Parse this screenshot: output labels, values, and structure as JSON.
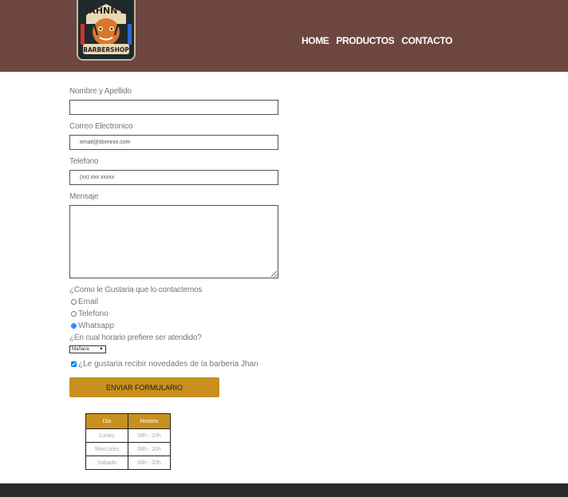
{
  "logo": {
    "line1": "JAHNN'S",
    "line2": "BARBERSHOP"
  },
  "nav": {
    "home": "HOME",
    "products": "PRODUCTOS",
    "contact": "CONTACTO"
  },
  "form": {
    "name_label": "Nombre y Apellido",
    "name_value": "",
    "email_label": "Correo Electronico",
    "email_placeholder": "email@dominio.com",
    "phone_label": "Telefono",
    "phone_placeholder": "(xx) xxx xxxxx",
    "message_label": "Mensaje",
    "message_value": "",
    "contact_question": "¿Como le Gustaria que lo contactemos",
    "contact_options": [
      "Email",
      "Telefono",
      "Whatsapp"
    ],
    "contact_selected": "Whatsapp",
    "schedule_question": "¿En cual horario prefiere ser atendido?",
    "schedule_selected": "Mañana",
    "newsletter_label": "¿Le gustaria recibir novedades de la barberia Jhan",
    "newsletter_checked": true,
    "submit_label": "ENVIAR FORMULARIO"
  },
  "hours_table": {
    "headers": [
      "Dia",
      "Horario"
    ],
    "rows": [
      [
        "Lunes",
        "08h - 20h"
      ],
      [
        "Miercoles",
        "08h - 20h"
      ],
      [
        "Sabado",
        "08h - 20h"
      ]
    ]
  },
  "colors": {
    "header": "#6d473f",
    "accent": "#c8901e",
    "footer": "#2b2b2b"
  }
}
